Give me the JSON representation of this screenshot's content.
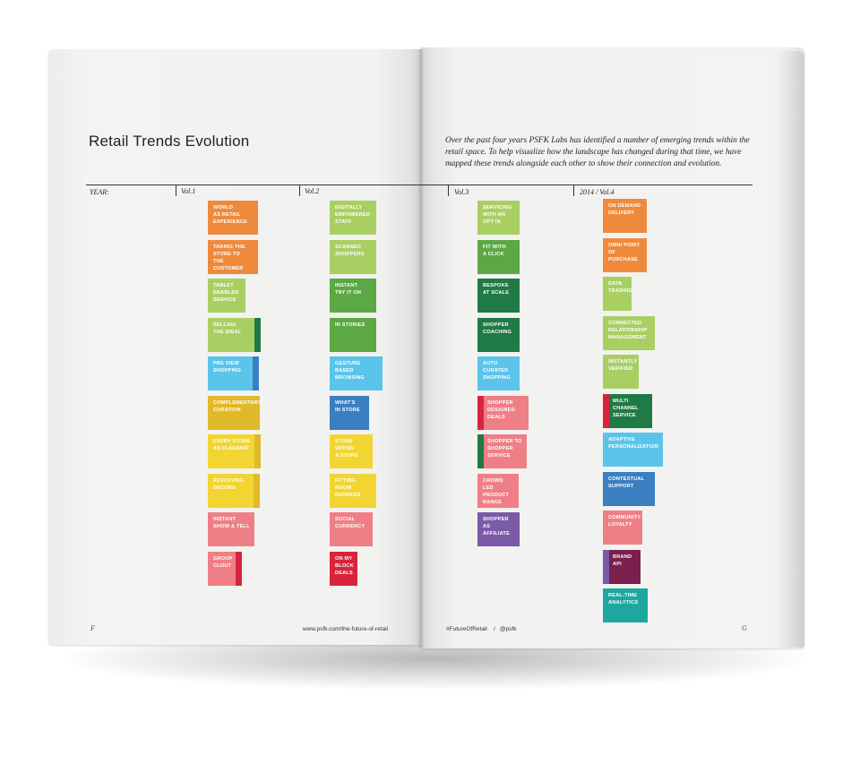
{
  "title": "Retail Trends Evolution",
  "intro": "Over the past four years PSFK Labs has identified a number of emerging trends within the retail space. To help visualize how the landscape has changed during that time, we have mapped these trends alongside each other to show their connection and evolution.",
  "year_label": "YEAR:",
  "volumes": [
    "Vol.1",
    "Vol.2",
    "Vol.3",
    "2014 / Vol.4"
  ],
  "footer": {
    "left_page_number": "F",
    "left_url": "www.psfk.com/the-future-of-retail",
    "right_hashtag": "#FutureOfRetail",
    "right_separator": "/",
    "right_handle": "@psfk",
    "right_page_number": "G"
  },
  "colors": {
    "orange": "#ef8a3c",
    "light_green": "#a9cf63",
    "dark_green": "#1f7a45",
    "green": "#5ca844",
    "light_blue": "#5bc4ea",
    "blue": "#3a7fc2",
    "mustard": "#e0b92a",
    "yellow": "#f2d533",
    "pink": "#ef7f86",
    "red": "#d8253d",
    "purple": "#7b5aa8",
    "plum": "#7a1f4e",
    "teal": "#1ea7a0"
  },
  "columns": [
    {
      "tiles": [
        {
          "label": "WORLD\nAS RETAIL\nEXPERIENCE",
          "color": "#ef8a3c"
        },
        {
          "label": "TAKING THE\nSTORE TO\nTHE CUSTOMER",
          "color": "#ef8a3c"
        },
        {
          "label": "TABLET\nENABLED\nSERVICE",
          "color": "#a9cf63"
        },
        {
          "label": "SELLING\nTHE IDEAL",
          "color": "#a9cf63",
          "accent": "#1f7a45",
          "accent_side": "right"
        },
        {
          "label": "PRE VIEW\nSHOPPING",
          "color": "#5bc4ea",
          "accent": "#3a7fc2",
          "accent_side": "right"
        },
        {
          "label": "COMPLEMENTARY\nCURATION",
          "color": "#e0b92a"
        },
        {
          "label": "EVERY STORE\nAS FLAGSHIP",
          "color": "#f2d533",
          "accent": "#e0b92a",
          "accent_side": "right"
        },
        {
          "label": "REVOLVING\nDECORE",
          "color": "#f2d533",
          "accent": "#e0b92a",
          "accent_side": "right"
        },
        {
          "label": "INSTANT\nSHOW & TELL",
          "color": "#ef7f86"
        },
        {
          "label": "GROUP\nCLOUT",
          "color": "#ef7f86",
          "accent": "#d8253d",
          "accent_side": "right"
        }
      ]
    },
    {
      "tiles": [
        {
          "label": "DIGITALLY\nEMPOWERED\nSTAFF",
          "color": "#a9cf63"
        },
        {
          "label": "SCANNED\nSHOPPERS",
          "color": "#a9cf63"
        },
        {
          "label": "INSTANT\nTRY IT ON",
          "color": "#5ca844"
        },
        {
          "label": "IN STORIES",
          "color": "#5ca844"
        },
        {
          "label": "GESTURE BASED\nBROWSING",
          "color": "#5bc4ea"
        },
        {
          "label": "WHAT'S\nIN STORE",
          "color": "#3a7fc2"
        },
        {
          "label": "STORE\nWITHIN\nA STORE",
          "color": "#f2d533"
        },
        {
          "label": "FITTING\nROOM\nREDRESS",
          "color": "#f2d533"
        },
        {
          "label": "SOCIAL\nCURRENCY",
          "color": "#ef7f86"
        },
        {
          "label": "ON MY\nBLOCK\nDEALS",
          "color": "#d8253d"
        }
      ]
    },
    {
      "tiles": [
        {
          "label": "SERVICING\nWITH AN\nOPT IN",
          "color": "#a9cf63"
        },
        {
          "label": "FIT WITH\nA CLICK",
          "color": "#5ca844"
        },
        {
          "label": "BESPOKE\nAT SCALE",
          "color": "#1f7a45"
        },
        {
          "label": "SHOPPER\nCOACHING",
          "color": "#1f7a45"
        },
        {
          "label": "AUTO\nCURATED\nSHOPPING",
          "color": "#5bc4ea"
        },
        {
          "label": "SHOPPER\nDESIGNED\nDEALS",
          "color": "#ef7f86",
          "accent": "#d8253d",
          "accent_side": "left"
        },
        {
          "label": "SHOPPER TO\nSHOPPER\nSERVICE",
          "color": "#ef7f86",
          "accent": "#1f7a45",
          "accent_side": "left"
        },
        {
          "label": "CROWD LED\nPRODUCT\nRANGE",
          "color": "#ef7f86"
        },
        {
          "label": "SHOPPER AS\nAFFILIATE",
          "color": "#7b5aa8"
        }
      ]
    },
    {
      "tiles": [
        {
          "label": "ON DEMAND\nDELIVERY",
          "color": "#ef8a3c"
        },
        {
          "label": "OMNI POINT\nOF PURCHASE",
          "color": "#ef8a3c"
        },
        {
          "label": "DATA\nTRADING",
          "color": "#a9cf63"
        },
        {
          "label": "CONNECTED\nRELATIONSHIP\nMANAGEMENT",
          "color": "#a9cf63"
        },
        {
          "label": "INSTANTLY\nVERIFIED",
          "color": "#a9cf63"
        },
        {
          "label": "MULTI\nCHANNEL\nSERVICE",
          "color": "#1f7a45",
          "accent": "#d8253d",
          "accent_side": "left"
        },
        {
          "label": "ADAPTIVE\nPERSONALIZATION",
          "color": "#5bc4ea"
        },
        {
          "label": "CONTEXTUAL\nSUPPORT",
          "color": "#3a7fc2"
        },
        {
          "label": "COMMUNITY\nLOYALTY",
          "color": "#ef7f86"
        },
        {
          "label": "BRAND\nAPI",
          "color": "#7a1f4e",
          "accent": "#7b5aa8",
          "accent_side": "left"
        },
        {
          "label": "REAL-TIME\nANALYTICS",
          "color": "#1ea7a0"
        }
      ]
    }
  ]
}
